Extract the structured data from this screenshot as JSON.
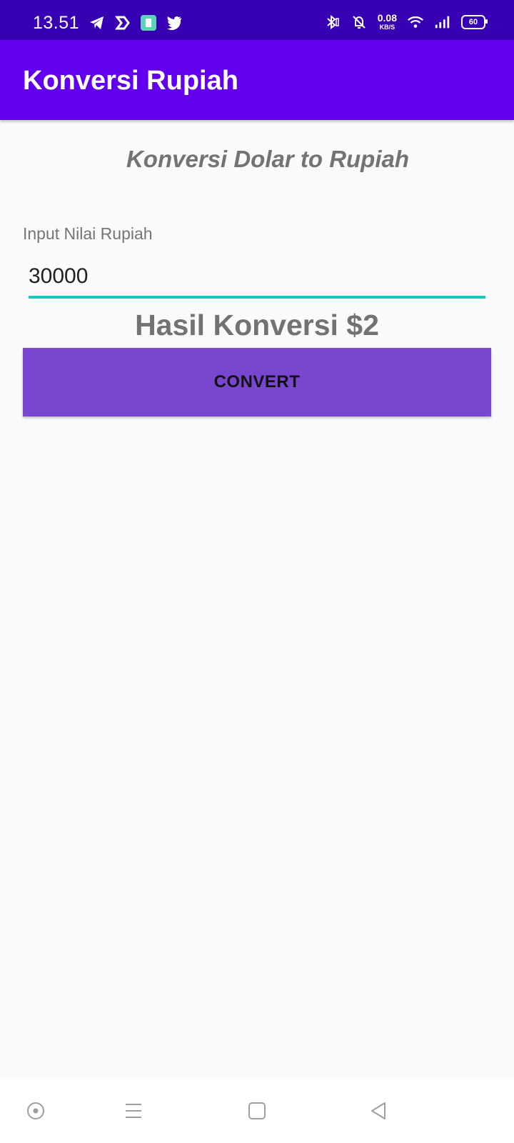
{
  "status_bar": {
    "time": "13.51",
    "net_speed_value": "0.08",
    "net_speed_unit": "KB/S",
    "battery": "60",
    "left_icons": [
      "telegram-icon",
      "app-icon",
      "calculator-icon",
      "twitter-icon"
    ],
    "right_icons": [
      "bluetooth-icon",
      "mute-icon",
      "wifi-icon",
      "signal-icon",
      "battery-icon"
    ]
  },
  "app_bar": {
    "title": "Konversi Rupiah"
  },
  "main": {
    "subtitle": "Konversi Dolar to Rupiah",
    "input_label": "Input Nilai Rupiah",
    "input_value": "30000",
    "result": "Hasil Konversi $2",
    "convert_label": "CONVERT"
  },
  "nav_bar": {
    "icons": [
      "assistant-icon",
      "menu-icon",
      "home-icon",
      "back-icon"
    ]
  },
  "colors": {
    "status_bar": "#3700b3",
    "app_bar": "#6200ee",
    "button": "#7946d0",
    "input_underline": "#19c6c0"
  }
}
